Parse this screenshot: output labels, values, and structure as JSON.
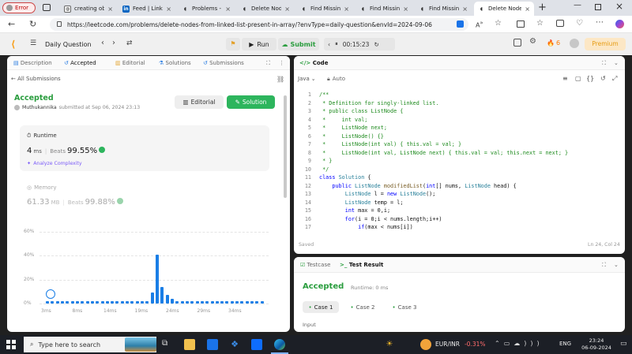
{
  "browser": {
    "error_label": "Error",
    "tabs": [
      {
        "label": "creating obje"
      },
      {
        "label": "Feed | Linked"
      },
      {
        "label": "Problems - Le"
      },
      {
        "label": "Delete Node"
      },
      {
        "label": "Find Missing"
      },
      {
        "label": "Find Missing"
      },
      {
        "label": "Find Missing"
      },
      {
        "label": "Delete Node"
      }
    ],
    "url": "https://leetcode.com/problems/delete-nodes-from-linked-list-present-in-array/?envType=daily-question&envId=2024-09-06"
  },
  "toolbar": {
    "daily_question": "Daily Question",
    "run": "Run",
    "submit": "Submit",
    "timer": "00:15:23",
    "streak": "6",
    "premium": "Premium"
  },
  "left": {
    "tabs": [
      "Description",
      "Accepted",
      "Editorial",
      "Solutions",
      "Submissions"
    ],
    "all_submissions": "All Submissions",
    "status": "Accepted",
    "user": "Muthukannika",
    "submitted_at": "submitted at Sep 06, 2024 23:13",
    "editorial_btn": "Editorial",
    "solution_btn": "Solution",
    "runtime_label": "Runtime",
    "runtime_value": "4",
    "runtime_unit": "ms",
    "beats_label": "Beats",
    "runtime_beats": "99.55%",
    "analyze": "Analyze Complexity",
    "memory_label": "Memory",
    "memory_value": "61.33",
    "memory_unit": "MB",
    "memory_beats": "99.88%"
  },
  "chart_data": {
    "type": "bar",
    "yticks": [
      "60%",
      "40%",
      "20%",
      "0%"
    ],
    "ylim": [
      0,
      60
    ],
    "xticks": [
      "3ms",
      "8ms",
      "14ms",
      "19ms",
      "24ms",
      "29ms",
      "34ms"
    ],
    "values": [
      2,
      2,
      2,
      2,
      2,
      2,
      2,
      2,
      2,
      2,
      2,
      2,
      2,
      2,
      2,
      2,
      2,
      2,
      2,
      2,
      2,
      9,
      41,
      14,
      7,
      4,
      2,
      2,
      2,
      2,
      2,
      2,
      2,
      2,
      2,
      2,
      2,
      2,
      2,
      2,
      2,
      2,
      2,
      2
    ],
    "highlight_index": 1,
    "color": "#1a7ee6"
  },
  "code": {
    "title": "Code",
    "language": "Java",
    "auto": "Auto",
    "saved": "Saved",
    "position": "Ln 24, Col 24",
    "lines": [
      [
        [
          "c-com",
          "/**"
        ]
      ],
      [
        [
          "c-com",
          " * Definition for singly-linked list."
        ]
      ],
      [
        [
          "c-com",
          " * public class ListNode {"
        ]
      ],
      [
        [
          "c-com",
          " *     int val;"
        ]
      ],
      [
        [
          "c-com",
          " *     ListNode next;"
        ]
      ],
      [
        [
          "c-com",
          " *     ListNode() {}"
        ]
      ],
      [
        [
          "c-com",
          " *     ListNode(int val) { this.val = val; }"
        ]
      ],
      [
        [
          "c-com",
          " *     ListNode(int val, ListNode next) { this.val = val; this.next = next; }"
        ]
      ],
      [
        [
          "c-com",
          " * }"
        ]
      ],
      [
        [
          "c-com",
          " */"
        ]
      ],
      [
        [
          "c-kw",
          "class "
        ],
        [
          "c-ty",
          "Solution"
        ],
        [
          "c-pl",
          " {"
        ]
      ],
      [
        [
          "c-pl",
          "    "
        ],
        [
          "c-kw",
          "public "
        ],
        [
          "c-ty",
          "ListNode "
        ],
        [
          "c-fn",
          "modifiedList"
        ],
        [
          "c-pl",
          "("
        ],
        [
          "c-kw",
          "int"
        ],
        [
          "c-pl",
          "[] nums, "
        ],
        [
          "c-ty",
          "ListNode"
        ],
        [
          "c-pl",
          " head) {"
        ]
      ],
      [
        [
          "c-pl",
          "        "
        ],
        [
          "c-ty",
          "ListNode"
        ],
        [
          "c-pl",
          " l = "
        ],
        [
          "c-kw",
          "new "
        ],
        [
          "c-ty",
          "ListNode"
        ],
        [
          "c-pl",
          "();"
        ]
      ],
      [
        [
          "c-pl",
          "        "
        ],
        [
          "c-ty",
          "ListNode"
        ],
        [
          "c-pl",
          " temp = l;"
        ]
      ],
      [
        [
          "c-pl",
          "        "
        ],
        [
          "c-kw",
          "int"
        ],
        [
          "c-pl",
          " max = 0,i;"
        ]
      ],
      [
        [
          "c-pl",
          "        "
        ],
        [
          "c-kw",
          "for"
        ],
        [
          "c-pl",
          "(i = 0;i < nums.length;i++)"
        ]
      ],
      [
        [
          "c-pl",
          "            "
        ],
        [
          "c-kw",
          "if"
        ],
        [
          "c-pl",
          "(max < nums[i])"
        ]
      ]
    ]
  },
  "result": {
    "testcase_tab": "Testcase",
    "result_tab": "Test Result",
    "status": "Accepted",
    "runtime": "Runtime: 0 ms",
    "cases": [
      "Case 1",
      "Case 2",
      "Case 3"
    ],
    "input_label": "Input"
  },
  "taskbar": {
    "search": "Type here to search",
    "ticker": "EUR/INR",
    "ticker_change": "-0.31%",
    "lang": "ENG",
    "time": "23:24",
    "date": "06-09-2024"
  }
}
